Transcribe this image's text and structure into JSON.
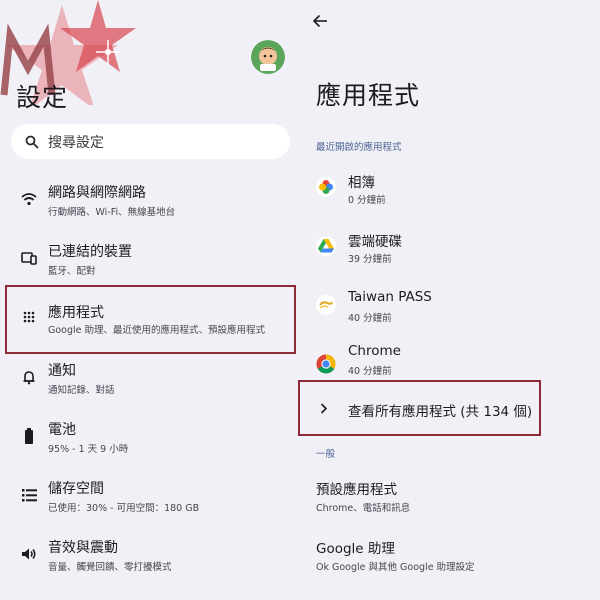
{
  "left": {
    "title": "設定",
    "search_label": "搜尋設定",
    "items": [
      {
        "title": "網路與網際網路",
        "subtitle": "行動網路、Wi-Fi、無線基地台",
        "icon": "wifi-icon"
      },
      {
        "title": "已連結的裝置",
        "subtitle": "藍牙、配對",
        "icon": "connected-devices-icon"
      },
      {
        "title": "應用程式",
        "subtitle": "Google 助理、最近使用的應用程式、預設應用程式",
        "icon": "apps-grid-icon"
      },
      {
        "title": "通知",
        "subtitle": "通知記錄、對話",
        "icon": "bell-icon"
      },
      {
        "title": "電池",
        "subtitle": "95% - 1 天 9 小時",
        "icon": "battery-icon"
      },
      {
        "title": "儲存空間",
        "subtitle": "已使用：30% - 可用空間：180 GB",
        "icon": "storage-icon"
      },
      {
        "title": "音效與震動",
        "subtitle": "音量、觸覺回饋、零打擾模式",
        "icon": "volume-icon"
      }
    ]
  },
  "right": {
    "title": "應用程式",
    "recent_label": "最近開啟的應用程式",
    "recent_apps": [
      {
        "name": "相簿",
        "time": "0 分鐘前",
        "icon": "photos-icon"
      },
      {
        "name": "雲端硬碟",
        "time": "39 分鐘前",
        "icon": "drive-icon"
      },
      {
        "name": "Taiwan PASS",
        "time": "40 分鐘前",
        "icon": "taiwan-pass-icon"
      },
      {
        "name": "Chrome",
        "time": "40 分鐘前",
        "icon": "chrome-icon"
      }
    ],
    "see_all": "查看所有應用程式 (共 134 個)",
    "general_label": "一般",
    "general_items": [
      {
        "title": "預設應用程式",
        "subtitle": "Chrome、電話和訊息"
      },
      {
        "title": "Google 助理",
        "subtitle": "Ok Google 與其他 Google 助理設定"
      }
    ]
  },
  "colors": {
    "background": "#f0f0f6",
    "highlight_border": "#8d2a35",
    "section_label": "#4b6394"
  }
}
